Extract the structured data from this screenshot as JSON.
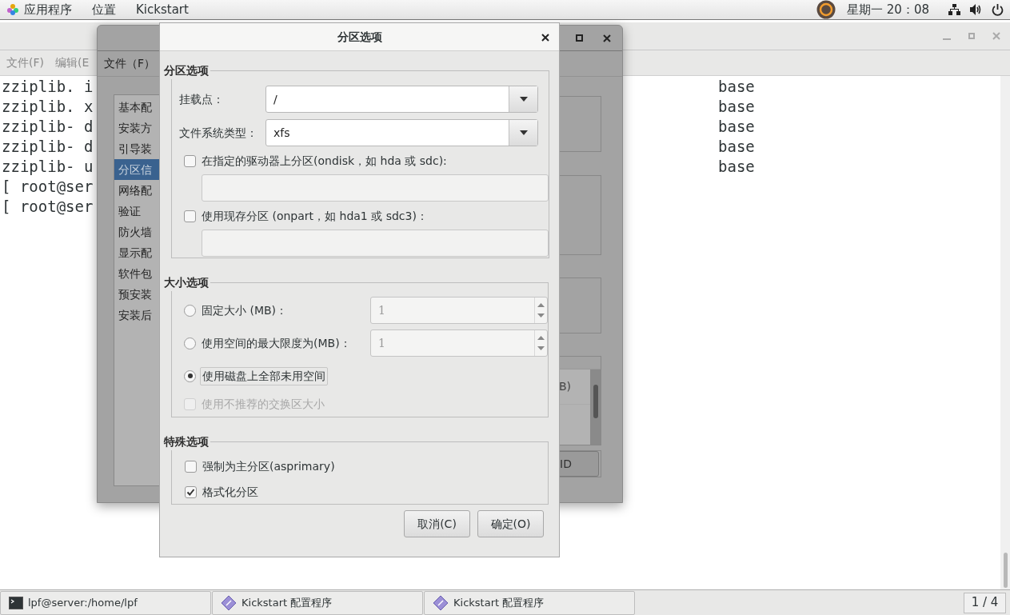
{
  "top_bar": {
    "menus": [
      "应用程序",
      "位置",
      "Kickstart"
    ],
    "clock": "星期一 20：08"
  },
  "terminal": {
    "menus": [
      "文件(F)",
      "编辑(E"
    ],
    "lines": [
      {
        "text": "zziplib. i",
        "column_2": "base"
      },
      {
        "text": "zziplib. x",
        "column_2": "base"
      },
      {
        "text": "zziplib- d",
        "column_2": "base"
      },
      {
        "text": "zziplib- d",
        "column_2": "base"
      },
      {
        "text": "zziplib- u",
        "column_2": "base"
      },
      {
        "text": "[ root@ser"
      },
      {
        "text": "[ root@ser"
      }
    ]
  },
  "kickstart": {
    "menu": "文件（F）",
    "sections": [
      {
        "label": "基本配",
        "selected": false
      },
      {
        "label": "安装方",
        "selected": false
      },
      {
        "label": "引导装",
        "selected": false
      },
      {
        "label": "分区信",
        "selected": true
      },
      {
        "label": "网络配",
        "selected": false
      },
      {
        "label": "验证",
        "selected": false
      },
      {
        "label": "防火墙",
        "selected": false
      },
      {
        "label": "显示配",
        "selected": false
      },
      {
        "label": "软件包",
        "selected": false
      },
      {
        "label": "预安装",
        "selected": false
      },
      {
        "label": "安装后",
        "selected": false
      }
    ],
    "list_text": "B)",
    "button": "ID"
  },
  "dialog": {
    "title": "分区选项",
    "partition_group": {
      "title": "分区选项",
      "mount_point": {
        "label": "挂载点：",
        "value": "/"
      },
      "fs_type": {
        "label": "文件系统类型：",
        "value": "xfs"
      },
      "ondisk": {
        "label": "在指定的驱动器上分区(ondisk，如 hda 或 sdc):",
        "checked": false
      },
      "onpart": {
        "label": "使用现存分区 (onpart，如 hda1 或 sdc3)：",
        "checked": false
      }
    },
    "size_group": {
      "title": "大小选项",
      "options": [
        {
          "label": "固定大小 (MB)：",
          "selected": false,
          "value": "1"
        },
        {
          "label": "使用空间的最大限度为(MB)：",
          "selected": false,
          "value": "1"
        },
        {
          "label": "使用磁盘上全部未用空间",
          "selected": true
        }
      ],
      "swap": {
        "label": "使用不推荐的交换区大小",
        "checked": false,
        "disabled": true
      }
    },
    "special_group": {
      "title": "特殊选项",
      "options": [
        {
          "label": "强制为主分区(asprimary)",
          "checked": false
        },
        {
          "label": "格式化分区",
          "checked": true
        }
      ]
    },
    "buttons": [
      "取消(C)",
      "确定(O)"
    ]
  },
  "taskbar": {
    "items": [
      {
        "kind": "terminal",
        "label": "lpf@server:/home/lpf"
      },
      {
        "kind": "app",
        "label": "Kickstart 配置程序"
      },
      {
        "kind": "app",
        "label": "Kickstart 配置程序"
      }
    ],
    "workspace": "1 / 4"
  }
}
